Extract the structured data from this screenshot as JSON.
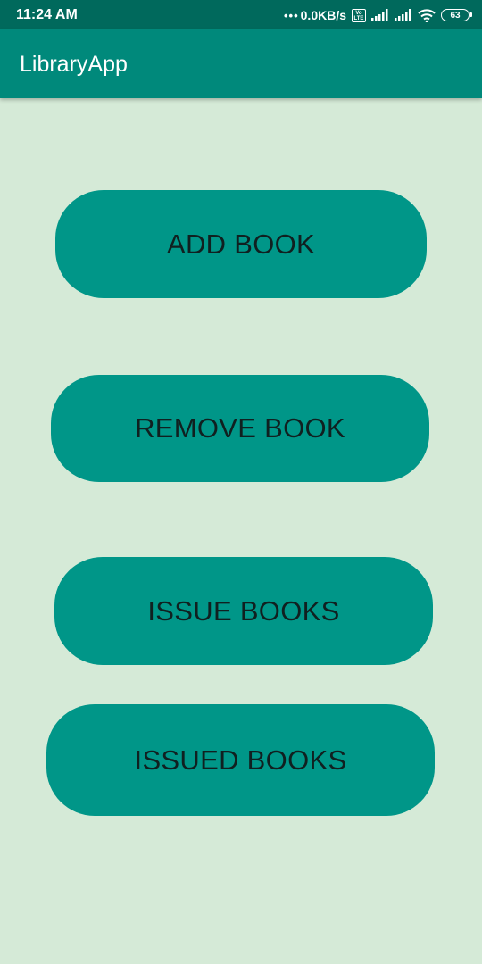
{
  "status_bar": {
    "time": "11:24 AM",
    "dots": "•••",
    "network_speed": "0.0KB/s",
    "volte_label": "Vo LTE",
    "signal_1_icon": "signal-strength-icon",
    "signal_2_icon": "signal-strength-icon",
    "wifi_icon": "wifi-icon",
    "battery_level": "63"
  },
  "app_bar": {
    "title": "LibraryApp"
  },
  "actions": {
    "add_book": "ADD BOOK",
    "remove_book": "REMOVE BOOK",
    "issue_books": "ISSUE BOOKS",
    "issued_books": "ISSUED BOOKS"
  },
  "colors": {
    "status_bar": "#00695c",
    "app_bar": "#00897b",
    "background": "#d5ead7",
    "button": "#009688",
    "button_text": "#102020"
  }
}
